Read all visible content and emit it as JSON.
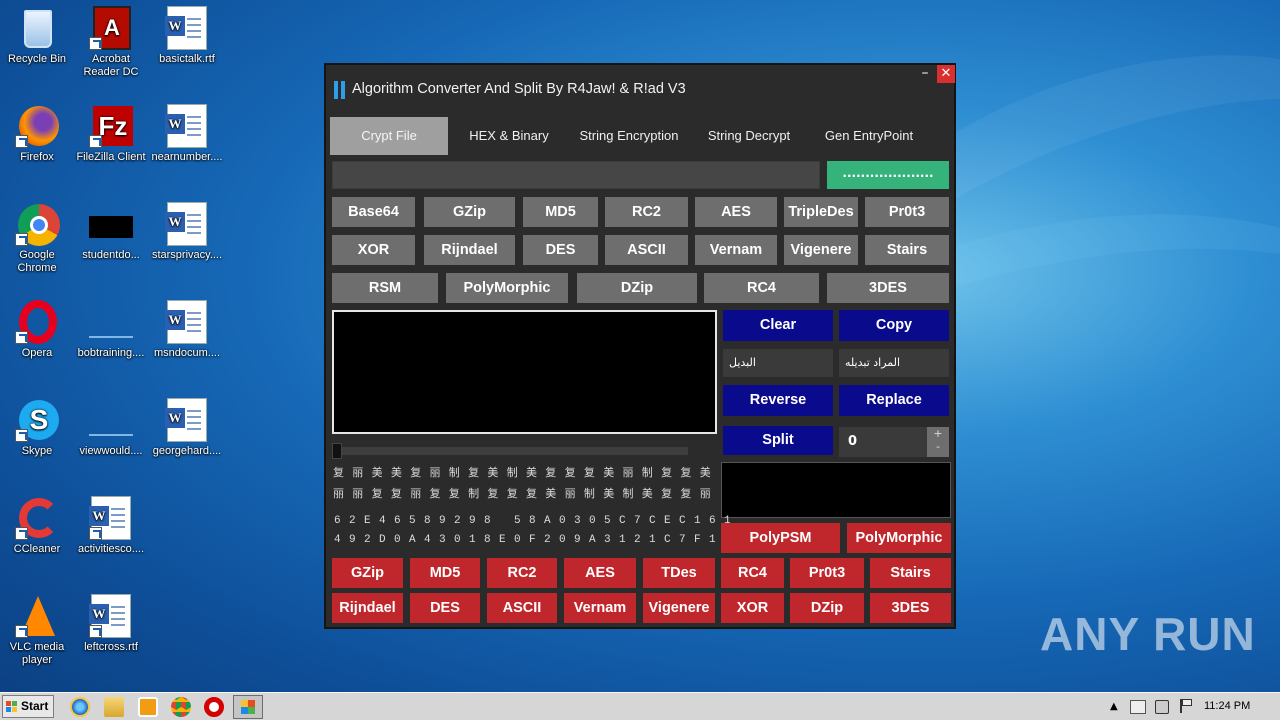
{
  "desktop": {
    "icons": [
      {
        "label": "Recycle Bin",
        "icon": "recycle-bin-icon"
      },
      {
        "label": "Acrobat Reader DC",
        "icon": "acrobat-icon"
      },
      {
        "label": "basictalk.rtf",
        "icon": "word-doc-icon"
      },
      {
        "label": "Firefox",
        "icon": "firefox-icon"
      },
      {
        "label": "FileZilla Client",
        "icon": "filezilla-icon"
      },
      {
        "label": "nearnumber....",
        "icon": "word-doc-icon"
      },
      {
        "label": "Google Chrome",
        "icon": "chrome-icon"
      },
      {
        "label": "studentdo...",
        "icon": "black-file-icon"
      },
      {
        "label": "starsprivacy....",
        "icon": "word-doc-icon"
      },
      {
        "label": "Opera",
        "icon": "opera-icon"
      },
      {
        "label": "bobtraining....",
        "icon": "blank-file-icon"
      },
      {
        "label": "msndocum....",
        "icon": "word-doc-icon"
      },
      {
        "label": "Skype",
        "icon": "skype-icon"
      },
      {
        "label": "viewwould....",
        "icon": "blank-file-icon"
      },
      {
        "label": "georgehard....",
        "icon": "word-doc-icon"
      },
      {
        "label": "CCleaner",
        "icon": "ccleaner-icon"
      },
      {
        "label": "activitiesco....",
        "icon": "word-doc-icon"
      },
      {
        "label": "VLC media player",
        "icon": "vlc-icon"
      },
      {
        "label": "leftcross.rtf",
        "icon": "word-doc-icon"
      }
    ]
  },
  "window": {
    "title": "Algorithm Converter And Split By R4Jaw! & R!ad V3",
    "minimize_label": "–",
    "close_label": "✕",
    "tabs": [
      "Crypt File",
      "HEX & Binary",
      "String Encryption",
      "String Decrypt",
      "Gen EntryPoint"
    ],
    "active_tab": "Crypt File",
    "top_button": "....................",
    "gray_buttons_row1": [
      "Base64",
      "GZip",
      "MD5",
      "RC2",
      "AES",
      "TripleDes",
      "Pr0t3"
    ],
    "gray_buttons_row2": [
      "XOR",
      "Rijndael",
      "DES",
      "ASCII",
      "Vernam",
      "Vigenere",
      "Stairs"
    ],
    "gray_buttons_row3": [
      "RSM",
      "PolyMorphic",
      "DZip",
      "RC4",
      "3DES"
    ],
    "action_buttons": {
      "clear": "Clear",
      "copy": "Copy",
      "reverse": "Reverse",
      "replace": "Replace",
      "split": "Split"
    },
    "replace_fields": {
      "find": "البديل",
      "target": "المراد تبديله"
    },
    "split_count": "0",
    "spin_up": "+",
    "spin_down": "-",
    "glyph_rows": [
      "复丽美美复丽制复美制美复复复美丽制复复美",
      "丽丽复复丽复复制复复复美丽制美制美复复丽"
    ],
    "hex_rows": [
      "62E46589298 58A0305C7CEC161",
      "492D0A43018E0F209A3121C7F1"
    ],
    "red_buttons_row1": [
      "PolyPSM",
      "PolyMorphic"
    ],
    "red_buttons_row2": [
      "GZip",
      "MD5",
      "RC2",
      "AES",
      "TDes",
      "RC4",
      "Pr0t3",
      "Stairs"
    ],
    "red_buttons_row3": [
      "Rijndael",
      "DES",
      "ASCII",
      "Vernam",
      "Vigenere",
      "XOR",
      "DZip",
      "3DES"
    ]
  },
  "taskbar": {
    "start_label": "Start",
    "clock": "11:24 PM",
    "pinned": [
      "internet-explorer-icon",
      "explorer-icon",
      "media-player-icon",
      "chrome-icon",
      "opera-icon",
      "app-window-icon"
    ]
  },
  "watermark": "ANY RUN",
  "colors": {
    "gray_btn": "#6e6e6e",
    "navy_btn": "#0a0a8c",
    "red_btn": "#c0272d",
    "green_btn": "#36b37a",
    "tab_active": "#9f9f9f"
  }
}
